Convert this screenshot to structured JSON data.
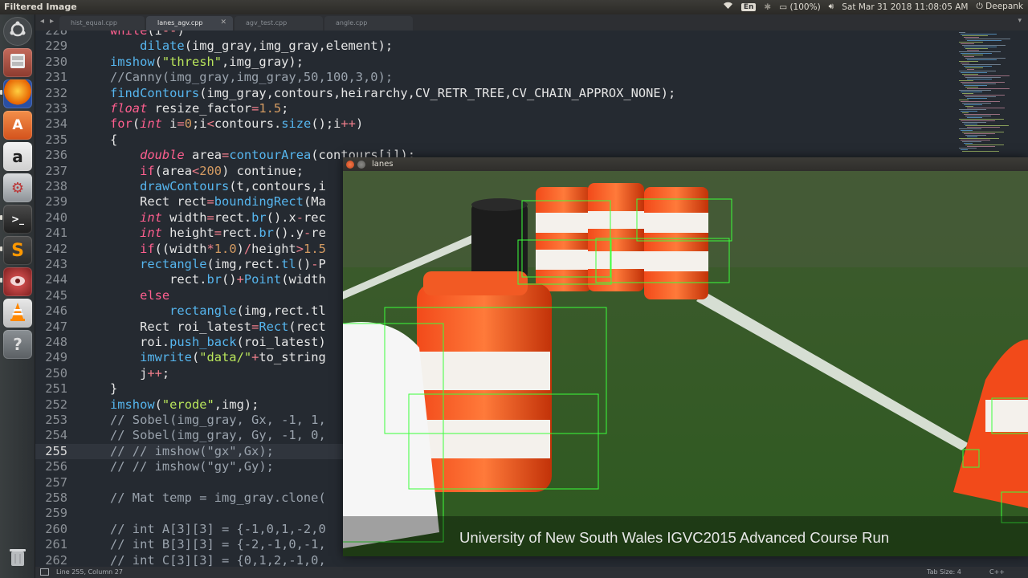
{
  "topbar": {
    "app_title": "Filtered Image",
    "keyboard_layout": "En",
    "battery": "(100%)",
    "datetime": "Sat Mar 31 2018 11:08:05 AM",
    "user": "Deepank"
  },
  "launcher": {
    "items": [
      {
        "name": "dash",
        "icon": "ubuntu-logo-icon"
      },
      {
        "name": "files",
        "icon": "file-cabinet-icon"
      },
      {
        "name": "firefox",
        "icon": "firefox-icon"
      },
      {
        "name": "software-center",
        "icon": "software-center-icon"
      },
      {
        "name": "amazon",
        "icon": "amazon-icon"
      },
      {
        "name": "system-settings",
        "icon": "settings-icon"
      },
      {
        "name": "terminal",
        "icon": "terminal-icon"
      },
      {
        "name": "sublime-text",
        "icon": "sublime-icon"
      },
      {
        "name": "image-viewer",
        "icon": "camera-icon"
      },
      {
        "name": "vlc",
        "icon": "vlc-cone-icon"
      },
      {
        "name": "help",
        "icon": "help-icon"
      },
      {
        "name": "trash",
        "icon": "trash-icon"
      }
    ]
  },
  "tabs": [
    {
      "label": "hist_equal.cpp",
      "active": false
    },
    {
      "label": "lanes_agv.cpp",
      "active": true
    },
    {
      "label": "agv_test.cpp",
      "active": false
    },
    {
      "label": "angle.cpp",
      "active": false
    }
  ],
  "editor": {
    "current_line": 255,
    "lines": [
      {
        "n": "228",
        "code": "while(i--)"
      },
      {
        "n": "229",
        "code": "    dilate(img_gray,img_gray,element);"
      },
      {
        "n": "230",
        "code": "imshow(\"thresh\",img_gray);"
      },
      {
        "n": "231",
        "code": "//Canny(img_gray,img_gray,50,100,3,0);"
      },
      {
        "n": "232",
        "code": "findContours(img_gray,contours,heirarchy,CV_RETR_TREE,CV_CHAIN_APPROX_NONE);"
      },
      {
        "n": "233",
        "code": "float resize_factor=1.5;"
      },
      {
        "n": "234",
        "code": "for(int i=0;i<contours.size();i++)"
      },
      {
        "n": "235",
        "code": "{"
      },
      {
        "n": "236",
        "code": "    double area=contourArea(contours[i]);"
      },
      {
        "n": "237",
        "code": "    if(area<200) continue;"
      },
      {
        "n": "238",
        "code": "    drawContours(t,contours,i"
      },
      {
        "n": "239",
        "code": "    Rect rect=boundingRect(Ma"
      },
      {
        "n": "240",
        "code": "    int width=rect.br().x-rec"
      },
      {
        "n": "241",
        "code": "    int height=rect.br().y-re"
      },
      {
        "n": "242",
        "code": "    if((width*1.0)/height>1.5"
      },
      {
        "n": "243",
        "code": "    rectangle(img,rect.tl()-P"
      },
      {
        "n": "244",
        "code": "        rect.br()+Point(width"
      },
      {
        "n": "245",
        "code": "    else"
      },
      {
        "n": "246",
        "code": "        rectangle(img,rect.tl"
      },
      {
        "n": "247",
        "code": "    Rect roi_latest=Rect(rect"
      },
      {
        "n": "248",
        "code": "    roi.push_back(roi_latest)"
      },
      {
        "n": "249",
        "code": "    imwrite(\"data/\"+to_string"
      },
      {
        "n": "250",
        "code": "    j++;"
      },
      {
        "n": "251",
        "code": "}"
      },
      {
        "n": "252",
        "code": "imshow(\"erode\",img);"
      },
      {
        "n": "253",
        "code": "// Sobel(img_gray, Gx, -1, 1,"
      },
      {
        "n": "254",
        "code": "// Sobel(img_gray, Gy, -1, 0,"
      },
      {
        "n": "255",
        "code": "// // imshow(\"gx\",Gx);"
      },
      {
        "n": "256",
        "code": "// // imshow(\"gy\",Gy);"
      },
      {
        "n": "257",
        "code": ""
      },
      {
        "n": "258",
        "code": "// Mat temp = img_gray.clone("
      },
      {
        "n": "259",
        "code": ""
      },
      {
        "n": "260",
        "code": "// int A[3][3] = {-1,0,1,-2,0"
      },
      {
        "n": "261",
        "code": "// int B[3][3] = {-2,-1,0,-1,"
      },
      {
        "n": "262",
        "code": "// int C[3][3] = {0,1,2,-1,0,"
      }
    ]
  },
  "statusbar": {
    "position": "Line 255, Column 27",
    "tab_size": "Tab Size: 4",
    "syntax": "C++"
  },
  "video_window": {
    "title": "lanes",
    "caption": "University of New South Wales IGVC2015 Advanced Course Run"
  }
}
